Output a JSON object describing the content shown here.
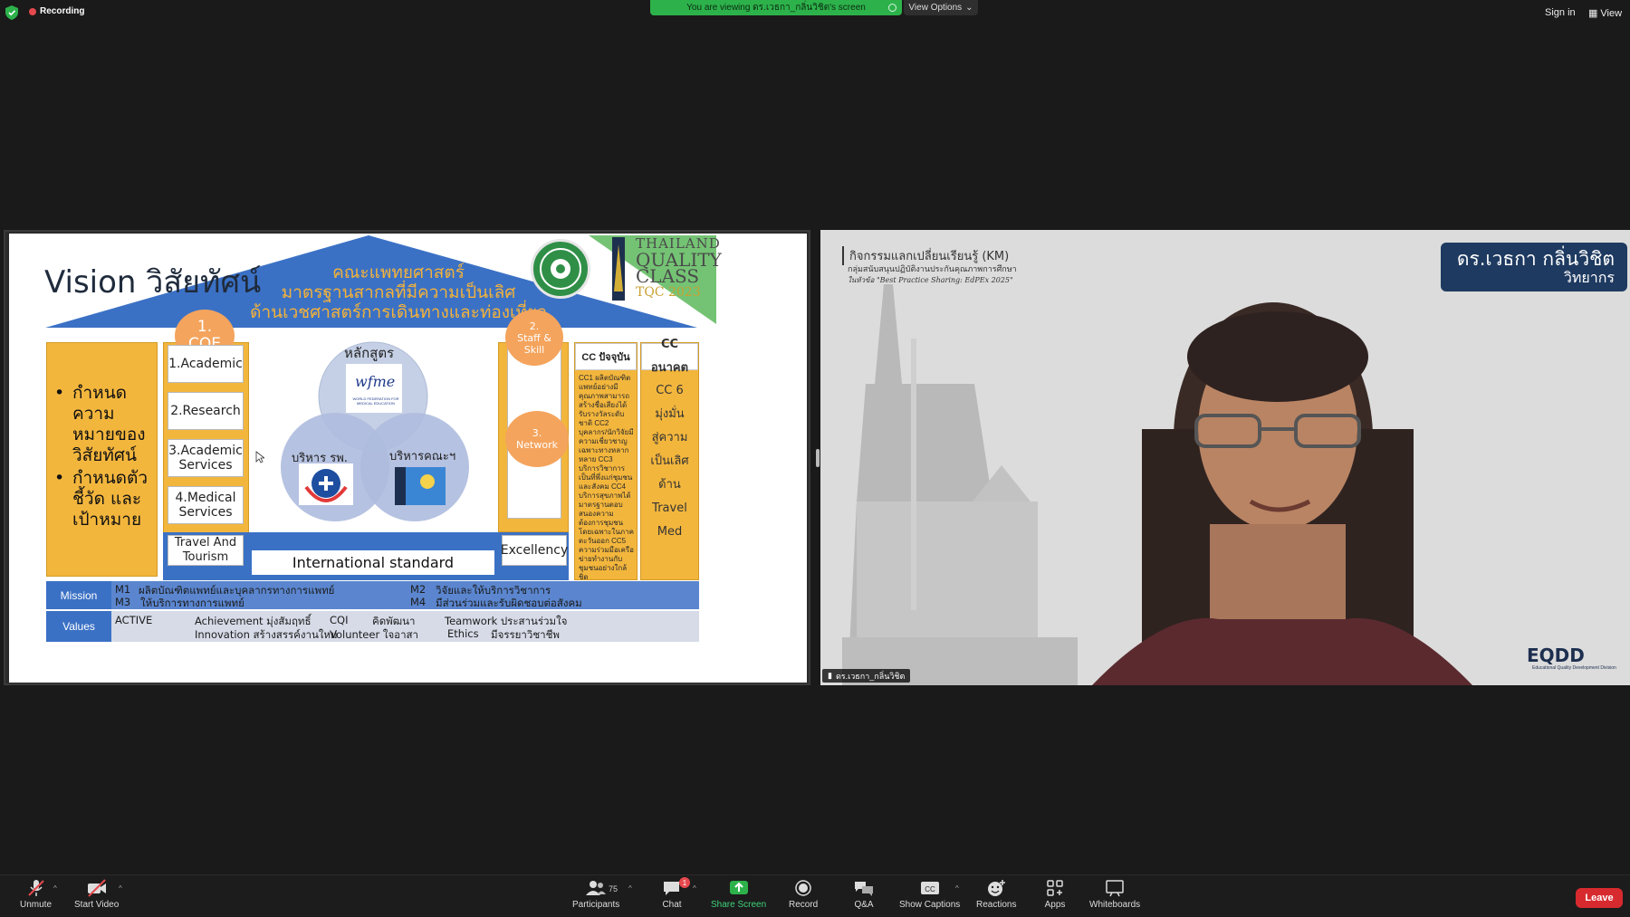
{
  "topbar": {
    "recording_label": "Recording",
    "viewing_banner": "You are viewing ดร.เวธกา_กลิ่นวิชิต's screen",
    "view_options_label": "View Options",
    "sign_in_label": "Sign in",
    "view_label": "View"
  },
  "slide": {
    "title": "Vision วิสัยทัศน์",
    "roof_lines": [
      "คณะแพทยศาสตร์",
      "มาตรฐานสากลที่มีความเป็นเลิศ",
      "ด้านเวชศาสตร์การเดินทางและท่องเที่ยว"
    ],
    "vision_bullets": [
      "กำหนดความหมายของวิสัยทัศน์",
      "กำหนดตัวชี้วัด และเป้าหมาย"
    ],
    "coe_label": "1.\nCOE",
    "coe_items": [
      "1.Academic",
      "2.Research",
      "3.Academic Services",
      "4.Medical Services",
      "Travel And Tourism"
    ],
    "venn": {
      "top_label": "หลักสูตร",
      "left_label": "บริหาร รพ.",
      "right_label": "บริหารคณะฯ",
      "wfme_text": "wfme",
      "wfme_sub": "WORLD FEDERATION FOR MEDICAL EDUCATION"
    },
    "international_standard": "International standard",
    "staff_skill_label": "2.\nStaff &\nSkill",
    "network_label": "3.\nNetwork",
    "excellency_label": "Excellency",
    "cc_current_header": "CC ปัจจุบัน",
    "cc_current_text": "CC1 ผลิตบัณฑิตแพทย์อย่างมีคุณภาพสามารถสร้างชื่อเสียงได้รับรางวัลระดับชาติ CC2 บุคลากร/นักวิจัยมีความเชี่ยวชาญเฉพาะทางหลากหลาย CC3 บริการวิชาการเป็นที่พึ่งแก่ชุมชนและสังคม CC4 บริการสุขภาพได้มาตรฐานตอบสนองความต้องการชุมชนโดยเฉพาะในภาคตะวันออก CC5 ความร่วมมือเครือข่ายทำงานกับชุมชนอย่างใกล้ชิด",
    "cc_future_header": "CC อนาคต",
    "cc_future_items": [
      "CC 6",
      "มุ่งมั่น",
      "สู่ความ",
      "เป็นเลิศ",
      "ด้าน",
      "Travel",
      "Med"
    ],
    "tqc": {
      "line1": "THAILAND",
      "line2": "QUALITY",
      "line3": "CLASS",
      "line4": "TQC 2023"
    },
    "mission": {
      "label": "Mission",
      "m1": "M1",
      "m1_text": "ผลิตบัณฑิตแพทย์และบุคลากรทางการแพทย์",
      "m2": "M2",
      "m2_text": "วิจัยและให้บริการวิชาการ",
      "m3": "M3",
      "m3_text": "ให้บริการทางการแพทย์",
      "m4": "M4",
      "m4_text": "มีส่วนร่วมและรับผิดชอบต่อสังคม"
    },
    "values": {
      "label": "Values",
      "active": "ACTIVE",
      "achievement": "Achievement มุ่งสัมฤทธิ์",
      "innovation": "Innovation สร้างสรรค์งานใหม่",
      "cqi": "CQI",
      "cqi_text": "คิดพัฒนา",
      "volunteer": "Volunteer ใจอาสา",
      "teamwork": "Teamwork ประสานร่วมใจ",
      "ethics": "Ethics",
      "ethics_text": "มีจรรยาวิชาชีพ"
    }
  },
  "video": {
    "km_title": "กิจกรรมแลกเปลี่ยนเรียนรู้ (KM)",
    "km_sub": "กลุ่มสนับสนุนปฏิบัติงานประกันคุณภาพการศึกษา",
    "km_sub2": "ในหัวข้อ \"Best Practice Sharing: EdPEx 2025\"",
    "speaker_name": "ดร.เวธกา กลิ่นวิชิต",
    "speaker_role": "วิทยากร",
    "participant_name": "ดร.เวธกา_กลิ่นวิชิต",
    "logo_text": "EQDD",
    "logo_sub": "Educational Quality Development Division"
  },
  "toolbar": {
    "unmute": "Unmute",
    "start_video": "Start Video",
    "participants": "Participants",
    "participants_count": "75",
    "chat": "Chat",
    "chat_badge": "1",
    "share_screen": "Share Screen",
    "record": "Record",
    "qa": "Q&A",
    "show_captions": "Show Captions",
    "reactions": "Reactions",
    "apps": "Apps",
    "whiteboards": "Whiteboards",
    "leave": "Leave"
  },
  "colors": {
    "share_green": "#2db24b",
    "leave_red": "#d72a2f",
    "slide_blue": "#3b71c5",
    "slide_yellow": "#f3b63d",
    "slide_orange": "#f4a45d"
  }
}
